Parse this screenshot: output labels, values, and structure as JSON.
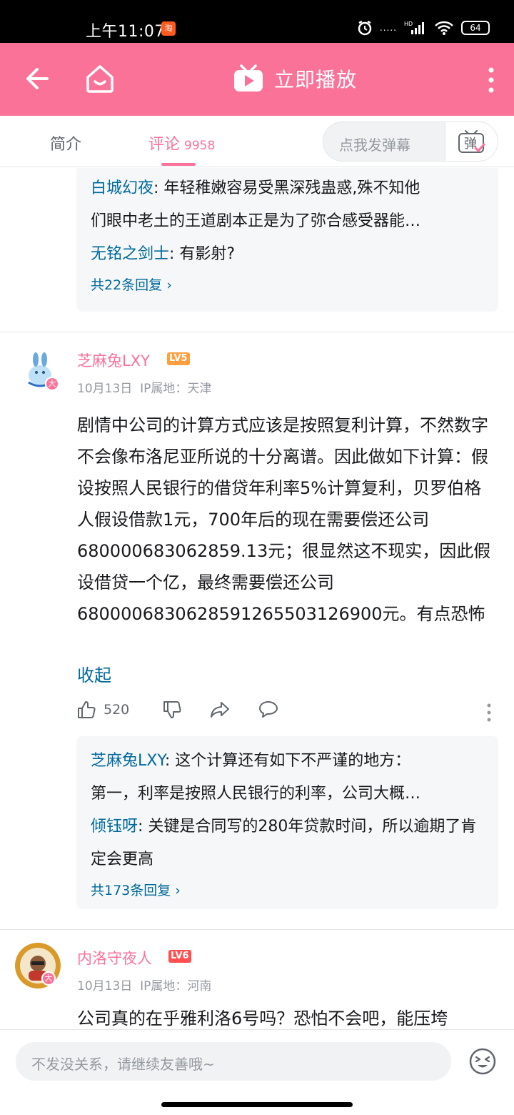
{
  "status_bar": {
    "time": "上午11:07",
    "taobao_icon": "淘",
    "network": "HD",
    "battery": "64"
  },
  "header": {
    "play_title": "立即播放"
  },
  "tabs": {
    "intro": "简介",
    "comments": "评论",
    "comments_count": "9958",
    "danmaku_placeholder": "点我发弹幕",
    "danmaku_button": "弹"
  },
  "thread1": {
    "replies": [
      {
        "user": "白城幻夜",
        "text": ": 年轻稚嫩容易受黑深残蛊惑,殊不知他",
        "text2": "们眼中老土的王道剧本正是为了弥合感受器能…"
      },
      {
        "user": "无铭之剑士",
        "text": ": 有影射?"
      }
    ],
    "more": "共22条回复 ›"
  },
  "comment1": {
    "username": "芝麻兔LXY",
    "level": "LV5",
    "badge": "大",
    "date": "10月13日",
    "ip": "IP属地：天津",
    "body": "剧情中公司的计算方式应该是按照复利计算，不然数字不会像布洛尼亚所说的十分离谱。因此做如下计算：假设按照人民银行的借贷年利率5%计算复利，贝罗伯格人假设借款1元，700年后的现在需要偿还公司680000683062859.13元；很显然这不现实，因此假设借贷一个亿，最终需要偿还公司6800006830628591265503126900元。有点恐怖",
    "collapse": "收起",
    "likes": "520",
    "replies": [
      {
        "user": "芝麻兔LXY",
        "text": ": 这个计算还有如下不严谨的地方：",
        "text2": "第一，利率是按照人民银行的利率，公司大概…"
      },
      {
        "user": "倾钰呀",
        "text": ": 关键是合同写的280年贷款时间，所以逾期了肯定会更高"
      }
    ],
    "more": "共173条回复 ›"
  },
  "comment2": {
    "username": "内洛守夜人",
    "level": "LV6",
    "badge": "大",
    "date": "10月13日",
    "ip": "IP属地：河南",
    "body": "公司真的在乎雅利洛6号吗？恐怕不会吧，能压垮"
  },
  "bottom": {
    "placeholder": "不发没关系，请继续友善哦~"
  },
  "colors": {
    "brand_pink": "#fb7299",
    "link_blue": "#00699d",
    "lv5_orange": "#ff9f3f",
    "lv6_red": "#ff4f4f"
  }
}
